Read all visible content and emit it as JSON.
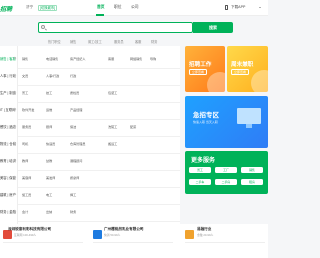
{
  "header": {
    "logo": "招聘",
    "city": "济宁",
    "switch_city": "[切换城市]",
    "nav": [
      "首页",
      "职位",
      "公司"
    ],
    "download": "下载APP"
  },
  "search": {
    "placeholder": "",
    "button": "搜索"
  },
  "hot_links": [
    "热门职位",
    "销售",
    "普工/技工",
    "服务员",
    "客服",
    "财务"
  ],
  "categories": [
    {
      "label": "销售 | 客服",
      "cells": [
        "销售",
        "电话销售",
        "房产经纪人",
        "客服",
        "网络销售",
        "导购"
      ]
    },
    {
      "label": "人事 | 行政",
      "cells": [
        "文员",
        "人事/行政",
        "行政"
      ]
    },
    {
      "label": "生产 | 制造",
      "cells": [
        "普工",
        "技工",
        "质检员",
        "包装工"
      ]
    },
    {
      "label": "IT | 互联网",
      "cells": [
        "软件开发",
        "运维",
        "产品经理"
      ]
    },
    {
      "label": "餐饮 | 酒店",
      "cells": [
        "服务员",
        "厨师",
        "保洁",
        "洗碗工",
        "配菜"
      ]
    },
    {
      "label": "物流 | 仓储",
      "cells": [
        "司机",
        "快递员",
        "仓库管理员",
        "搬运工"
      ]
    },
    {
      "label": "教育 | 培训",
      "cells": [
        "教师",
        "幼教",
        "课程顾问"
      ]
    },
    {
      "label": "美容 | 保健",
      "cells": [
        "美容师",
        "美发师",
        "按摩师"
      ]
    },
    {
      "label": "建筑 | 房产",
      "cells": [
        "施工员",
        "电工",
        "焊工"
      ]
    },
    {
      "label": "财务 | 金融",
      "cells": [
        "会计",
        "出纳",
        "财务"
      ]
    }
  ],
  "cards": {
    "card1_title": "招聘工作",
    "card1_btn": "立即查看",
    "card2_title": "周末兼职",
    "card2_btn": "立即查看"
  },
  "zone": {
    "title": "急招专区",
    "subtitle": "快速入职 当天入职"
  },
  "more": {
    "title": "更多服务",
    "buttons": [
      "普工",
      "工厂",
      "销售",
      "二手车",
      "二手房",
      "租房"
    ]
  },
  "companies": [
    {
      "name": "深圳锐意利彩科技有限公司",
      "meta": "互联网  100-499人"
    },
    {
      "name": "广州樱桃然乳业有限公司",
      "meta": "快消  50-99人"
    },
    {
      "name": "易融行业",
      "meta": "金融  20-99人"
    }
  ],
  "colors": {
    "brand": "#00b259",
    "blue": "#2f7cf6",
    "orange": "#ff8a1a",
    "yellow": "#ffb01f"
  }
}
